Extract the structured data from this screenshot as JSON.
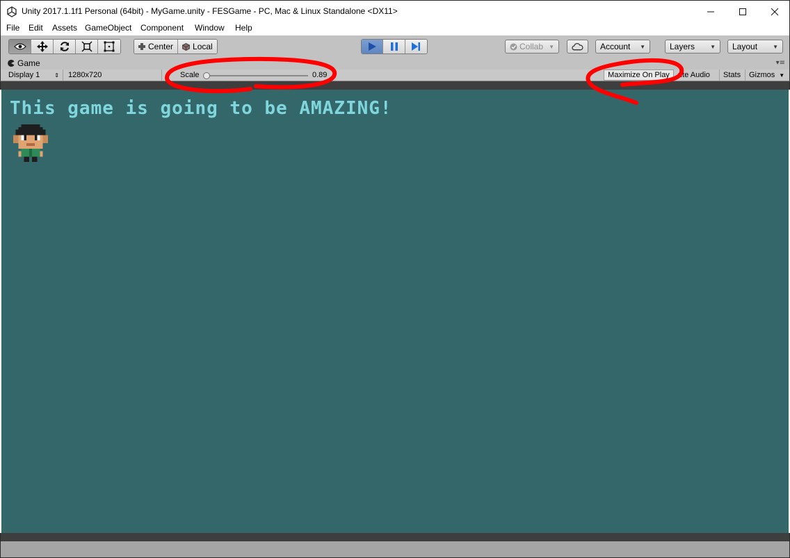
{
  "window": {
    "title": "Unity 2017.1.1f1 Personal (64bit) - MyGame.unity - FESGame - PC, Mac & Linux Standalone <DX11>"
  },
  "menu": {
    "items": [
      "File",
      "Edit",
      "Assets",
      "GameObject",
      "Component",
      "Window",
      "Help"
    ]
  },
  "toolbar": {
    "tools": [
      "hand-tool",
      "move-tool",
      "rotate-tool",
      "scale-tool",
      "rect-tool"
    ],
    "pivot_center": "Center",
    "pivot_local": "Local",
    "collab": "Collab",
    "account": "Account",
    "layers": "Layers",
    "layout": "Layout"
  },
  "game_tab": {
    "label": "Game"
  },
  "game_toolbar": {
    "display": "Display 1",
    "resolution": "1280x720",
    "scale_label": "Scale",
    "scale_value": "0.89",
    "maximize_on_play": "Maximize On Play",
    "mute_audio": "ute Audio",
    "stats": "Stats",
    "gizmos": "Gizmos"
  },
  "game": {
    "text": "This game is going to be AMAZING!"
  },
  "colors": {
    "game_background": "#33676a",
    "game_text": "#7fd6dc",
    "annotation": "#ff0000",
    "play_active": "#5f86c2"
  }
}
